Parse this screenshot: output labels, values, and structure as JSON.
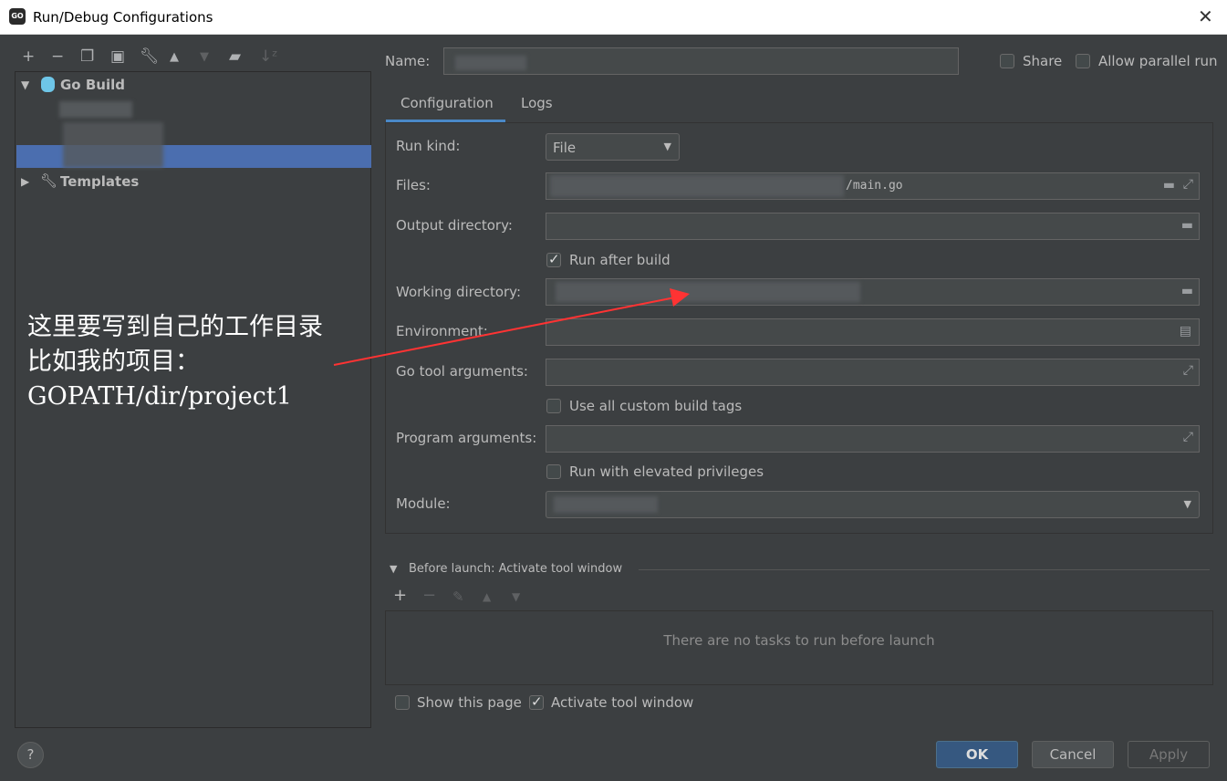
{
  "window": {
    "title": "Run/Debug Configurations",
    "logo": "GO"
  },
  "left": {
    "toolbar": [
      "plus-icon",
      "minus-icon",
      "copy-icon",
      "save-icon",
      "wrench-icon",
      "arrow-up-icon",
      "arrow-down-icon",
      "new-folder-icon",
      "sort-icon"
    ],
    "tree": [
      {
        "label": "Go Build",
        "expanded": true,
        "icon": "gopher-icon"
      },
      {
        "label": "Templates",
        "expanded": false,
        "icon": "wrench-icon"
      }
    ]
  },
  "form": {
    "name_label": "Name:",
    "share_label": "Share",
    "parallel_label": "Allow parallel run",
    "tabs": [
      "Configuration",
      "Logs"
    ],
    "run_kind_label": "Run kind:",
    "run_kind_value": "File",
    "files_label": "Files:",
    "files_value": "/main.go",
    "output_label": "Output directory:",
    "run_after_build": "Run after build",
    "working_dir_label": "Working directory:",
    "env_label": "Environment:",
    "go_tool_label": "Go tool arguments:",
    "custom_tags": "Use all custom build tags",
    "program_args_label": "Program arguments:",
    "elevated": "Run with elevated privileges",
    "module_label": "Module:"
  },
  "before_launch": {
    "title": "Before launch: Activate tool window",
    "empty": "There are no tasks to run before launch",
    "show_page": "Show this page",
    "activate": "Activate tool window"
  },
  "buttons": {
    "help": "?",
    "ok": "OK",
    "cancel": "Cancel",
    "apply": "Apply"
  },
  "annotation": {
    "lines": [
      "这里要写到自己的工作目录",
      "比如我的项目：",
      "GOPATH/dir/project1"
    ],
    "color": "#ff3333"
  },
  "colors": {
    "selection": "#4b6eaf",
    "accent": "#4a88c7",
    "background": "#3c3f41"
  }
}
